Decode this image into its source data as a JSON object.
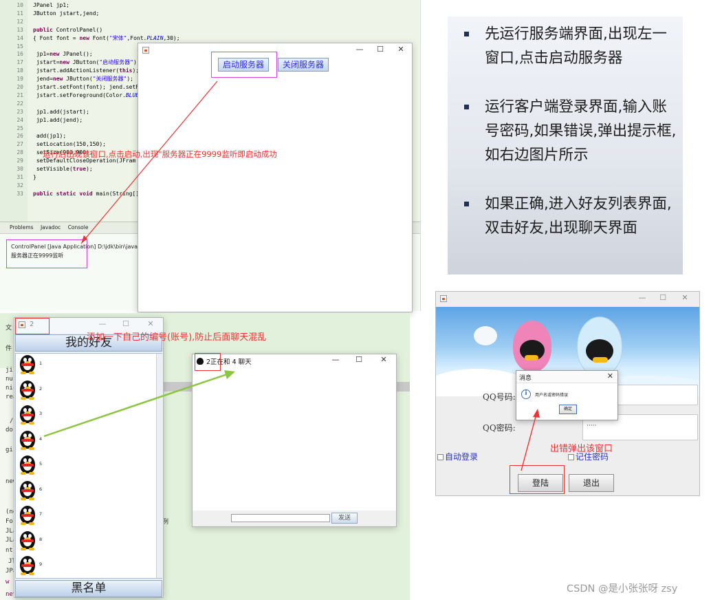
{
  "ide": {
    "code_lines": [
      {
        "n": "10",
        "html": "JPanel jp1;"
      },
      {
        "n": "11",
        "html": "JButton jstart,jend;"
      },
      {
        "n": "12",
        "html": ""
      },
      {
        "n": "13",
        "html": "<span class='kw'>public</span> ControlPanel()"
      },
      {
        "n": "14",
        "html": "{  Font font = <span class='kw'>new</span> Font(<span class='str'>\"宋体\"</span>,Font.<span class='fld'>PLAIN</span>,30);"
      },
      {
        "n": "15",
        "html": ""
      },
      {
        "n": "16",
        "html": "  jp1=<span class='kw'>new</span> JPanel();"
      },
      {
        "n": "17",
        "html": "  jstart=<span class='kw'>new</span> JButton(<span class='str'>\"启动服务器\"</span>);"
      },
      {
        "n": "18",
        "html": "  jstart.addActionListener(<span class='kw'>this</span>);"
      },
      {
        "n": "19",
        "html": "  jend=<span class='kw'>new</span> JButton(<span class='str'>\"关闭服务器\"</span>);"
      },
      {
        "n": "20",
        "html": "  jstart.setFont(font); jend.setFont"
      },
      {
        "n": "21",
        "html": "  jstart.setForeground(Color.<span class='fld'>BLUE</span>"
      },
      {
        "n": "22",
        "html": ""
      },
      {
        "n": "23",
        "html": "  jp1.add(jstart);"
      },
      {
        "n": "24",
        "html": "  jp1.add(jend);"
      },
      {
        "n": "25",
        "html": ""
      },
      {
        "n": "26",
        "html": "  add(jp1);"
      },
      {
        "n": "27",
        "html": "  setLocation(150,150);"
      },
      {
        "n": "28",
        "html": "  setSize(900,900);"
      },
      {
        "n": "29",
        "html": "  setDefaultCloseOperation(JFram"
      },
      {
        "n": "30",
        "html": "  setVisible(<span class='kw'>true</span>);"
      },
      {
        "n": "31",
        "html": "}"
      },
      {
        "n": "32",
        "html": ""
      },
      {
        "n": "33",
        "html": "<span class='kw'>public static void</span> main(String[] args"
      }
    ],
    "tabs": [
      "Problems",
      "Javadoc",
      "Console"
    ],
    "console_header": "ControlPanel [Java Application] D:\\jdk\\bin\\javaw",
    "console_output": "服务器正在9999监听"
  },
  "server_window": {
    "start_button": "启动服务器",
    "stop_button": "关闭服务器",
    "annotation": "运行后出现该窗口,点击启动,出现\"服务器正在9999监听即启动成功"
  },
  "instructions": [
    "先运行服务端界面,出现左一窗口,点击启动服务器",
    "运行客户端登录界面,输入账号密码,如果错误,弹出提示框,如右边图片所示",
    "如果正确,进入好友列表界面,双击好友,出现聊天界面"
  ],
  "login_window": {
    "qq_number_label": "QQ号码:",
    "qq_password_label": "QQ密码:",
    "password_value": "·····",
    "auto_login": "自动登录",
    "remember_password": "记住密码",
    "login_button": "登陆",
    "exit_button": "退出",
    "annotation": "出错弹出该窗口",
    "dialog": {
      "title": "消息",
      "message": "用户名或密码错误",
      "ok_button": "确定"
    }
  },
  "friends_window": {
    "title": "2",
    "header_button": "我的好友",
    "footer_button": "黑名单",
    "friends": [
      "1",
      "2",
      "3",
      "4",
      "5",
      "6",
      "7",
      "8",
      "9"
    ],
    "annotation": "添加一下自己的编号(账号),防止后面聊天混乱"
  },
  "chat_window": {
    "title": "2正在和 4  聊天",
    "send_button": "发送"
  },
  "edge_fragments": [
    "文",
    "件",
    "ji",
    "nu",
    "nic",
    "rea",
    "/",
    "do",
    "gir",
    "new",
    "(ne",
    "For",
    "JLa",
    "JLa",
    "nt(",
    "JT",
    "JPa",
    "w",
    "nev",
    "例"
  ],
  "watermark": "CSDN @是小张张呀  zsy"
}
